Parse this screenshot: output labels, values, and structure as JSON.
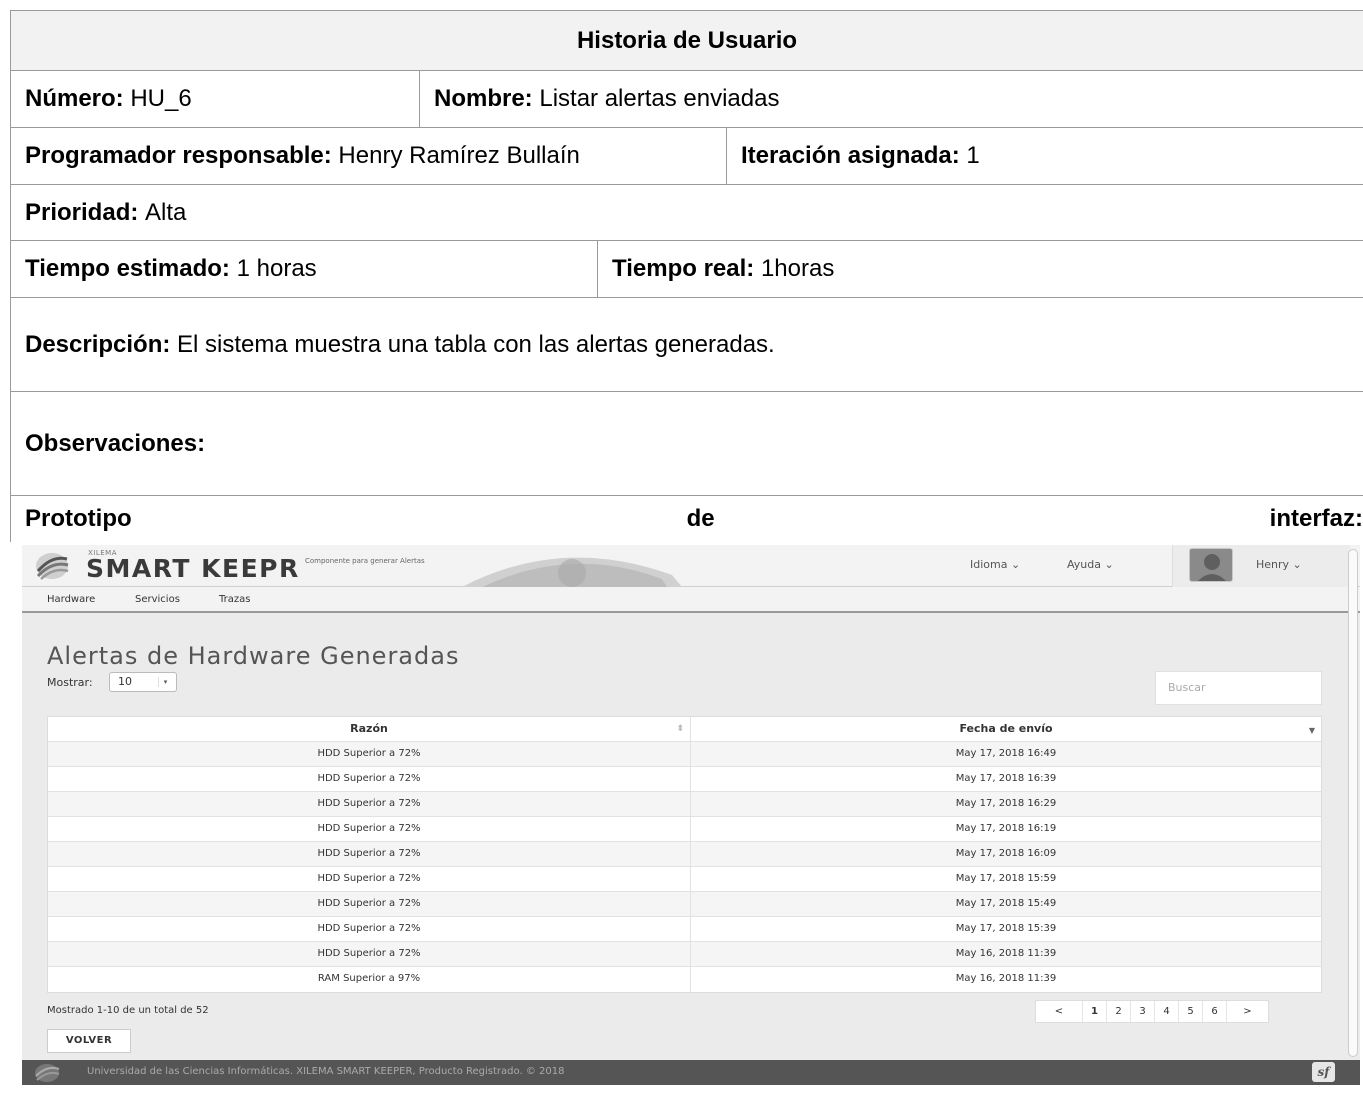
{
  "doc": {
    "title": "Historia de Usuario",
    "numero_label": "Número:",
    "numero_value": "HU_6",
    "nombre_label": "Nombre:",
    "nombre_value": "Listar alertas enviadas",
    "programador_label": "Programador responsable:",
    "programador_value": "Henry Ramírez Bullaín",
    "iteracion_label": "Iteración asignada:",
    "iteracion_value": "1",
    "prioridad_label": "Prioridad:",
    "prioridad_value": "Alta",
    "tiempo_est_label": "Tiempo estimado:",
    "tiempo_est_value": "1 horas",
    "tiempo_real_label": "Tiempo real:",
    "tiempo_real_value": "1horas",
    "descripcion_label": "Descripción:",
    "descripcion_value": "El sistema muestra una tabla con las alertas generadas.",
    "observaciones_label": "Observaciones:",
    "prototipo_words": [
      "Prototipo",
      "de",
      "interfaz:"
    ]
  },
  "app": {
    "logo_small": "XILEMA",
    "logo_text": "SMART KEEPR",
    "logo_sub": "Componente para generar Alertas",
    "menu_idioma": "Idioma",
    "menu_ayuda": "Ayuda",
    "user_name": "Henry",
    "nav": [
      "Hardware",
      "Servicios",
      "Trazas"
    ],
    "page_title": "Alertas de Hardware Generadas",
    "show_label": "Mostrar:",
    "show_value": "10",
    "search_placeholder": "Buscar",
    "columns": [
      "Razón",
      "Fecha de envío"
    ],
    "rows": [
      [
        "HDD Superior a 72%",
        "May 17, 2018 16:49"
      ],
      [
        "HDD Superior a 72%",
        "May 17, 2018 16:39"
      ],
      [
        "HDD Superior a 72%",
        "May 17, 2018 16:29"
      ],
      [
        "HDD Superior a 72%",
        "May 17, 2018 16:19"
      ],
      [
        "HDD Superior a 72%",
        "May 17, 2018 16:09"
      ],
      [
        "HDD Superior a 72%",
        "May 17, 2018 15:59"
      ],
      [
        "HDD Superior a 72%",
        "May 17, 2018 15:49"
      ],
      [
        "HDD Superior a 72%",
        "May 17, 2018 15:39"
      ],
      [
        "HDD Superior a 72%",
        "May 16, 2018 11:39"
      ],
      [
        "RAM Superior a 97%",
        "May 16, 2018 11:39"
      ]
    ],
    "footer_info": "Mostrado 1-10 de un total de 52",
    "pager": [
      "<",
      "1",
      "2",
      "3",
      "4",
      "5",
      "6",
      ">"
    ],
    "pager_active": "1",
    "back_button": "VOLVER",
    "footer_text": "Universidad de las Ciencias Informáticas. XILEMA SMART KEEPER, Producto Registrado. © 2018",
    "colors": {
      "footer_bg": "#555555",
      "header_bg": "#f3f3f3",
      "body_bg": "#ebebeb"
    },
    "icons": [
      "xilema-logo-icon",
      "chevron-down-icon",
      "avatar-icon",
      "sort-icon",
      "symfony-icon"
    ]
  }
}
